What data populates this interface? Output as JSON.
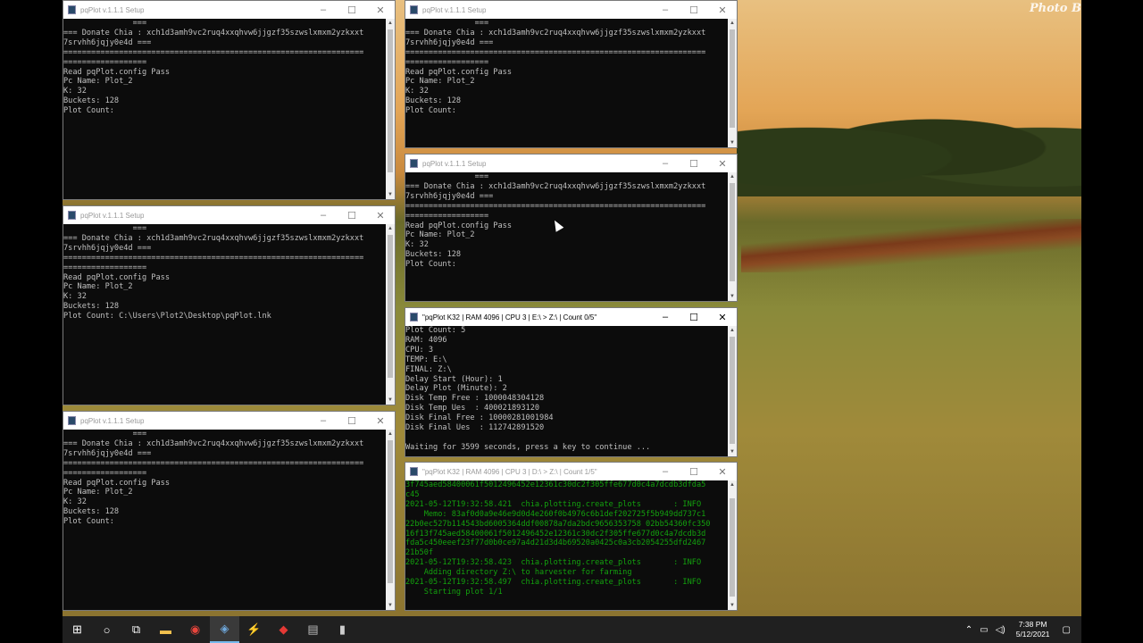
{
  "desktop": {
    "watermark": "Photo B"
  },
  "windows": [
    {
      "id": "w1",
      "title": "pqPlot v.1.1.1 Setup",
      "active": false,
      "green": false,
      "lines": [
        "               ===",
        "=== Donate Chia : xch1d3amh9vc2ruq4xxqhvw6jjgzf35szwslxmxm2yzkxxt",
        "7srvhh6jqjy0e4d ===",
        "=================================================================",
        "==================",
        "Read pqPlot.config Pass",
        "Pc Name: Plot_2",
        "K: 32",
        "Buckets: 128",
        "Plot Count:"
      ]
    },
    {
      "id": "w2",
      "title": "pqPlot v.1.1.1 Setup",
      "active": false,
      "green": false,
      "lines": [
        "               ===",
        "=== Donate Chia : xch1d3amh9vc2ruq4xxqhvw6jjgzf35szwslxmxm2yzkxxt",
        "7srvhh6jqjy0e4d ===",
        "=================================================================",
        "==================",
        "Read pqPlot.config Pass",
        "Pc Name: Plot_2",
        "K: 32",
        "Buckets: 128",
        "Plot Count: C:\\Users\\Plot2\\Desktop\\pqPlot.lnk"
      ]
    },
    {
      "id": "w3",
      "title": "pqPlot v.1.1.1 Setup",
      "active": false,
      "green": false,
      "lines": [
        "               ===",
        "=== Donate Chia : xch1d3amh9vc2ruq4xxqhvw6jjgzf35szwslxmxm2yzkxxt",
        "7srvhh6jqjy0e4d ===",
        "=================================================================",
        "==================",
        "Read pqPlot.config Pass",
        "Pc Name: Plot_2",
        "K: 32",
        "Buckets: 128",
        "Plot Count:"
      ]
    },
    {
      "id": "w4",
      "title": "pqPlot v.1.1.1 Setup",
      "active": false,
      "green": false,
      "lines": [
        "               ===",
        "=== Donate Chia : xch1d3amh9vc2ruq4xxqhvw6jjgzf35szwslxmxm2yzkxxt",
        "7srvhh6jqjy0e4d ===",
        "=================================================================",
        "==================",
        "Read pqPlot.config Pass",
        "Pc Name: Plot_2",
        "K: 32",
        "Buckets: 128",
        "Plot Count:"
      ]
    },
    {
      "id": "w5",
      "title": "pqPlot v.1.1.1 Setup",
      "active": false,
      "green": false,
      "lines": [
        "               ===",
        "=== Donate Chia : xch1d3amh9vc2ruq4xxqhvw6jjgzf35szwslxmxm2yzkxxt",
        "7srvhh6jqjy0e4d ===",
        "=================================================================",
        "==================",
        "Read pqPlot.config Pass",
        "Pc Name: Plot_2",
        "K: 32",
        "Buckets: 128",
        "Plot Count:"
      ]
    },
    {
      "id": "w6",
      "title": "\"pqPlot K32 | RAM 4096 | CPU 3 | E:\\ > Z:\\ | Count 0/5\"",
      "active": true,
      "green": false,
      "lines": [
        "Plot Count: 5",
        "RAM: 4096",
        "CPU: 3",
        "TEMP: E:\\",
        "FINAL: Z:\\",
        "Delay Start (Hour): 1",
        "Delay Plot (Minute): 2",
        "Disk Temp Free : 1000048304128",
        "Disk Temp Ues  : 400021893120",
        "Disk Final Free : 10000281001984",
        "Disk Final Ues  : 112742891520",
        "",
        "Waiting for 3599 seconds, press a key to continue ..."
      ]
    },
    {
      "id": "w7",
      "title": "\"pqPlot K32 | RAM 4096 | CPU 3 | D:\\ > Z:\\ | Count 1/5\"",
      "active": false,
      "green": true,
      "lines": [
        "3f745aed58400061f5012496452e12361c30dc2f305ffe677d0c4a7dcdb3dfda5",
        "c45",
        "2021-05-12T19:32:58.421  chia.plotting.create_plots       : INFO",
        "    Memo: 83af0d0a9e46e9d0d4e260f0b4976c6b1def202725f5b949dd737c1",
        "22b0ec527b114543bd6005364ddf00878a7da2bdc9656353758 02bb54360fc350",
        "16f13f745aed58400061f5012496452e12361c30dc2f305ffe677d0c4a7dcdb3d",
        "fda5c450eeef23f77d0b0ce97a4d21d3d4b69520a0425c0a3cb2054255dfd2467",
        "21b50f",
        "2021-05-12T19:32:58.423  chia.plotting.create_plots       : INFO",
        "    Adding directory Z:\\ to harvester for farming",
        "2021-05-12T19:32:58.497  chia.plotting.create_plots       : INFO",
        "    Starting plot 1/1"
      ]
    }
  ],
  "taskbar": {
    "items": [
      {
        "name": "start-button",
        "glyph": "⊞"
      },
      {
        "name": "search-button",
        "glyph": "○"
      },
      {
        "name": "task-view-button",
        "glyph": "⧉"
      },
      {
        "name": "file-explorer-button",
        "glyph": "▬"
      },
      {
        "name": "chrome-button",
        "glyph": "◉"
      },
      {
        "name": "pqplot-button",
        "glyph": "◈"
      },
      {
        "name": "app-red-button",
        "glyph": "⚡"
      },
      {
        "name": "app-red2-button",
        "glyph": "◆"
      },
      {
        "name": "app-drive-button",
        "glyph": "▤"
      },
      {
        "name": "terminal-button",
        "glyph": "▮"
      }
    ],
    "tray": {
      "chevron": "⌃",
      "network": "▭",
      "volume": "◁)",
      "time": "7:38 PM",
      "date": "5/12/2021",
      "notifications": "▢"
    }
  },
  "colors": {
    "console_text": "#c0c0c0",
    "console_green": "#13a10e",
    "console_bg": "#0c0c0c",
    "taskbar_bg": "#202020"
  }
}
